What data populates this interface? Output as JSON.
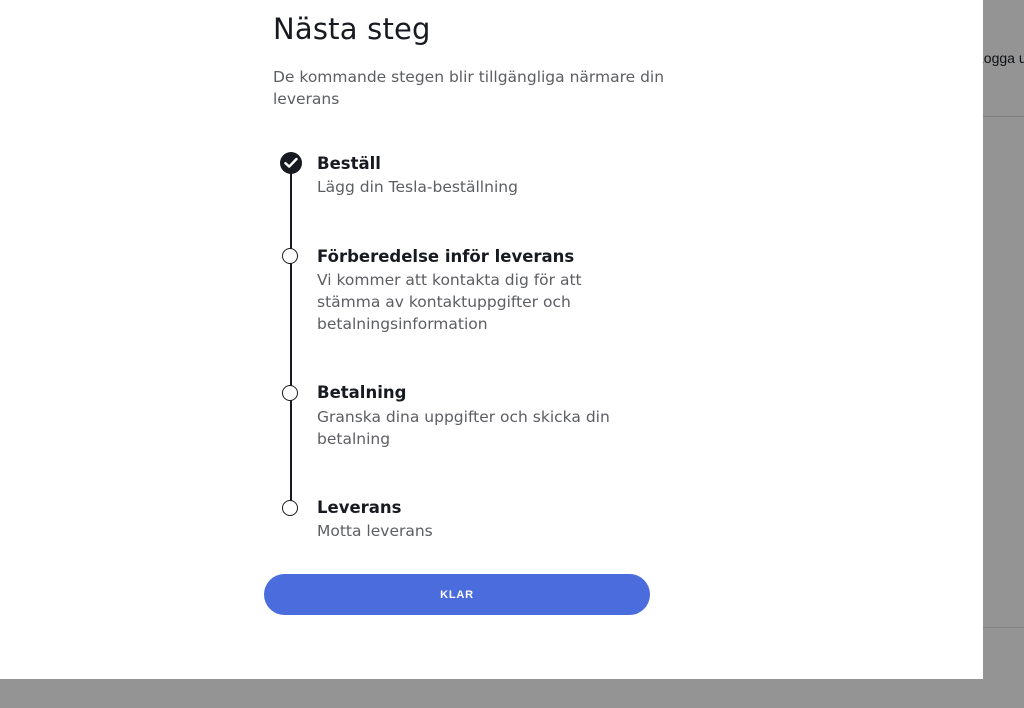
{
  "background": {
    "logout_label": "Logga ut"
  },
  "modal": {
    "title": "Nästa steg",
    "subtitle": "De kommande stegen blir tillgängliga närmare din leverans",
    "steps": [
      {
        "title": "Beställ",
        "description": "Lägg din Tesla-beställning",
        "status": "completed"
      },
      {
        "title": "Förberedelse inför leverans",
        "description": "Vi kommer att kontakta dig för att stämma av kontaktuppgifter och betalningsinformation",
        "status": "pending"
      },
      {
        "title": "Betalning",
        "description": "Granska dina uppgifter och skicka din betalning",
        "status": "pending"
      },
      {
        "title": "Leverans",
        "description": "Motta leverans",
        "status": "pending"
      }
    ],
    "done_button_label": "KLAR"
  },
  "colors": {
    "primary_button": "#4a6cdd",
    "text_primary": "#171a20",
    "text_secondary": "#5c5e62"
  },
  "icons": {
    "completed_step": "checkmark-circle-icon",
    "pending_step": "empty-circle-icon"
  }
}
